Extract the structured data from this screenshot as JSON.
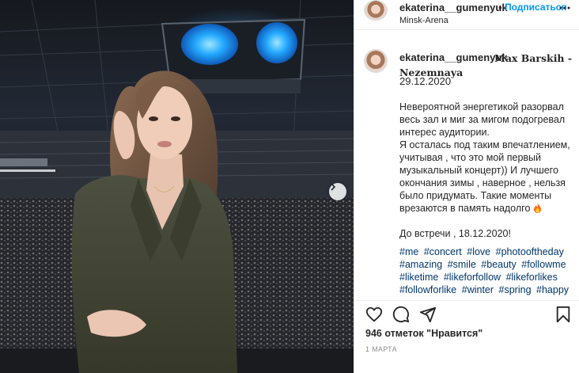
{
  "header": {
    "username": "ekaterina__gumenyuk",
    "dot": "•",
    "follow_label": "Подписаться",
    "location": "Minsk-Arena",
    "more_icon": "more-dots-icon"
  },
  "caption": {
    "username": "ekaterina__gumenyuk",
    "song": "Max Barskih - Nezemnaya",
    "date": "29.12.2020",
    "paragraph1": "Невероятной энергетикой разорвал весь зал и миг за мигом подогревал интерес аудитории.",
    "paragraph2": "Я осталась под таким впечатлением, учитывая , что это мой первый музыкальный концерт)) И лучшего окончания зимы , наверное , нельзя было придумать. Такие моменты врезаются в память надолго",
    "closing": "До встречи , 18.12.2020!",
    "hashtags": [
      "#me",
      "#concert",
      "#love",
      "#photooftheday",
      "#amazing",
      "#smile",
      "#beauty",
      "#followme",
      "#liketime",
      "#likeforfollow",
      "#likeforlikes",
      "#followforlike",
      "#winter",
      "#spring",
      "#happy"
    ]
  },
  "actions": {
    "like_icon": "heart-icon",
    "comment_icon": "comment-icon",
    "share_icon": "share-icon",
    "save_icon": "bookmark-icon"
  },
  "likes": {
    "count": "946 отметок",
    "suffix": "\"Нравится\""
  },
  "post_date": "1 МАРТА",
  "photo": {
    "next_icon": "chevron-right-icon"
  }
}
